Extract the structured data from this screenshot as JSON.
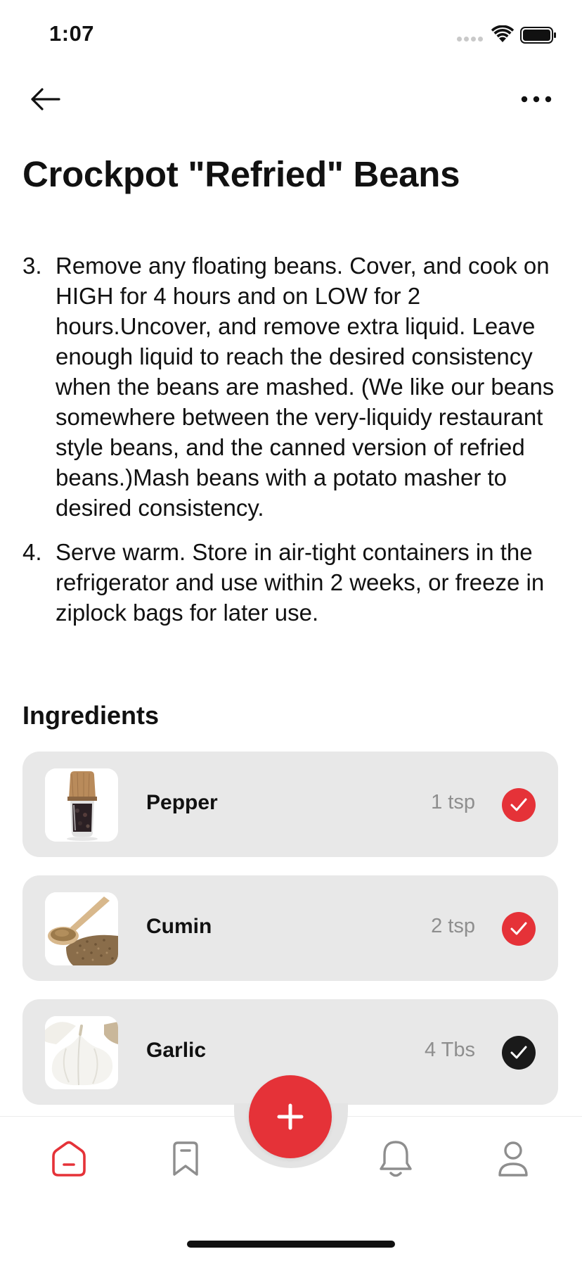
{
  "status": {
    "time": "1:07"
  },
  "title": "Crockpot \"Refried\" Beans",
  "steps": [
    {
      "number": "3.",
      "text": "Remove any floating beans. Cover, and cook on HIGH for 4 hours and on LOW for 2 hours.Uncover, and remove extra liquid. Leave enough liquid to reach the desired consistency when the beans are mashed. (We like our beans somewhere between the very-liquidy restaurant style beans, and the canned version of refried beans.)Mash beans with a potato masher to desired consistency."
    },
    {
      "number": "4.",
      "text": "Serve warm. Store in air-tight containers in the refrigerator and use within 2 weeks, or freeze in ziplock bags for later use."
    }
  ],
  "ingredients_heading": "Ingredients",
  "ingredients": [
    {
      "name": "Pepper",
      "quantity": "1 tsp",
      "checked_color": "#e53238",
      "image": "pepper-grinder"
    },
    {
      "name": "Cumin",
      "quantity": "2 tsp",
      "checked_color": "#e53238",
      "image": "cumin-spoon"
    },
    {
      "name": "Garlic",
      "quantity": "4 Tbs",
      "checked_color": "#1a1a1a",
      "image": "garlic-bulb"
    }
  ],
  "tabs": [
    {
      "icon": "home-icon",
      "active": true
    },
    {
      "icon": "bookmark-icon",
      "active": false
    },
    {
      "icon": "add-icon",
      "active": false
    },
    {
      "icon": "bell-icon",
      "active": false
    },
    {
      "icon": "profile-icon",
      "active": false
    }
  ],
  "colors": {
    "accent": "#e53238",
    "card": "#e8e8e8",
    "muted": "#8e8e8e"
  }
}
